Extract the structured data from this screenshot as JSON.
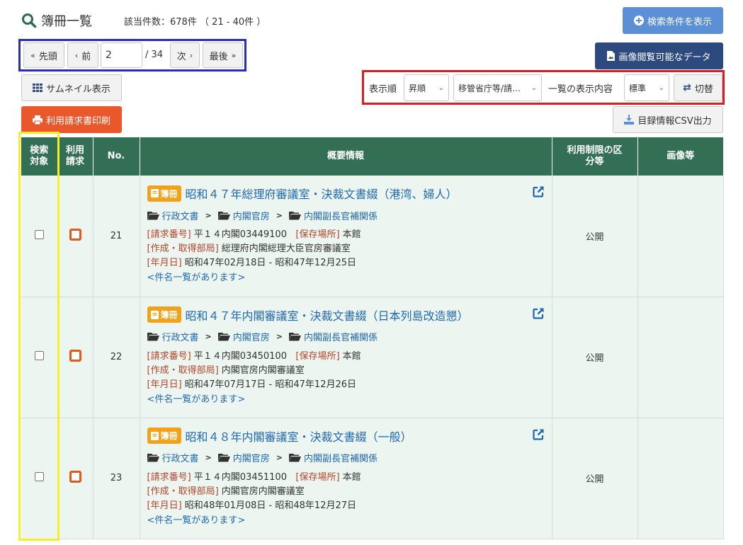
{
  "header": {
    "title": "簿冊一覧",
    "count_text": "該当件数：678件 （ 21 - 40件 ）"
  },
  "toolbar": {
    "show_conditions": "検索条件を表示",
    "image_data": "画像閲覧可能なデータ",
    "thumbnail": "サムネイル表示",
    "print_request": "利用請求書印刷",
    "csv_export": "目録情報CSV出力"
  },
  "pager": {
    "first": "先頭",
    "prev": "前",
    "page_value": "2",
    "total_pages": "/ 34",
    "next": "次",
    "last": "最後"
  },
  "sort": {
    "order_label": "表示順",
    "order_value": "昇順",
    "field_value": "移管省庁等/請…",
    "display_label": "一覧の表示内容",
    "display_value": "標準",
    "switch": "切替"
  },
  "table": {
    "headers": {
      "search_target": "検索\n対象",
      "request": "利用\n請求",
      "no": "No.",
      "summary": "概要情報",
      "restriction": "利用制限の区\n分等",
      "image": "画像等"
    },
    "badge_label": "簿冊",
    "rows": [
      {
        "no": "21",
        "title": "昭和４７年総理府審議室・決裁文書綴（港湾、婦人）",
        "breadcrumb": [
          "行政文書",
          "内閣官房",
          "内閣副長官補関係"
        ],
        "request_label": "[請求番号]",
        "request_no": "平１４内閣03449100",
        "location_label": "[保存場所]",
        "location": "本館",
        "dept_label": "[作成・取得部局]",
        "dept": "総理府内閣総理大臣官房審議室",
        "date_label": "[年月日]",
        "date": "昭和47年02月18日 - 昭和47年12月25日",
        "items_link": "<件名一覧があります>",
        "restriction": "公開"
      },
      {
        "no": "22",
        "title": "昭和４７年内閣審議室・決裁文書綴（日本列島改造懇）",
        "breadcrumb": [
          "行政文書",
          "内閣官房",
          "内閣副長官補関係"
        ],
        "request_label": "[請求番号]",
        "request_no": "平１４内閣03450100",
        "location_label": "[保存場所]",
        "location": "本館",
        "dept_label": "[作成・取得部局]",
        "dept": "内閣官房内閣審議室",
        "date_label": "[年月日]",
        "date": "昭和47年07月17日 - 昭和47年12月26日",
        "items_link": "<件名一覧があります>",
        "restriction": "公開"
      },
      {
        "no": "23",
        "title": "昭和４８年内閣審議室・決裁文書綴（一般）",
        "breadcrumb": [
          "行政文書",
          "内閣官房",
          "内閣副長官補関係"
        ],
        "request_label": "[請求番号]",
        "request_no": "平１４内閣03451100",
        "location_label": "[保存場所]",
        "location": "本館",
        "dept_label": "[作成・取得部局]",
        "dept": "内閣官房内閣審議室",
        "date_label": "[年月日]",
        "date": "昭和48年01月08日 - 昭和48年12月27日",
        "items_link": "<件名一覧があります>",
        "restriction": "公開"
      }
    ]
  },
  "colors": {
    "header_green": "#336f55",
    "row_bg": "#ecf5f0",
    "link_blue": "#1f68b0",
    "badge_orange": "#f0a21a",
    "print_orange": "#e9572a",
    "navy_button": "#2c4a7e",
    "conditions_blue": "#5b8fd6",
    "highlight_blue": "#2c2cb8",
    "highlight_red": "#e01a22",
    "highlight_yellow": "#f5ef2a"
  },
  "icons": {
    "title": "search-icon",
    "conditions": "plus-circle-icon",
    "image_data": "file-image-icon",
    "thumbnail": "grid-icon",
    "print": "printer-icon",
    "csv": "download-icon",
    "switch": "swap-icon",
    "badge": "book-icon",
    "external": "external-link-icon",
    "breadcrumb": "folder-open-icon"
  }
}
